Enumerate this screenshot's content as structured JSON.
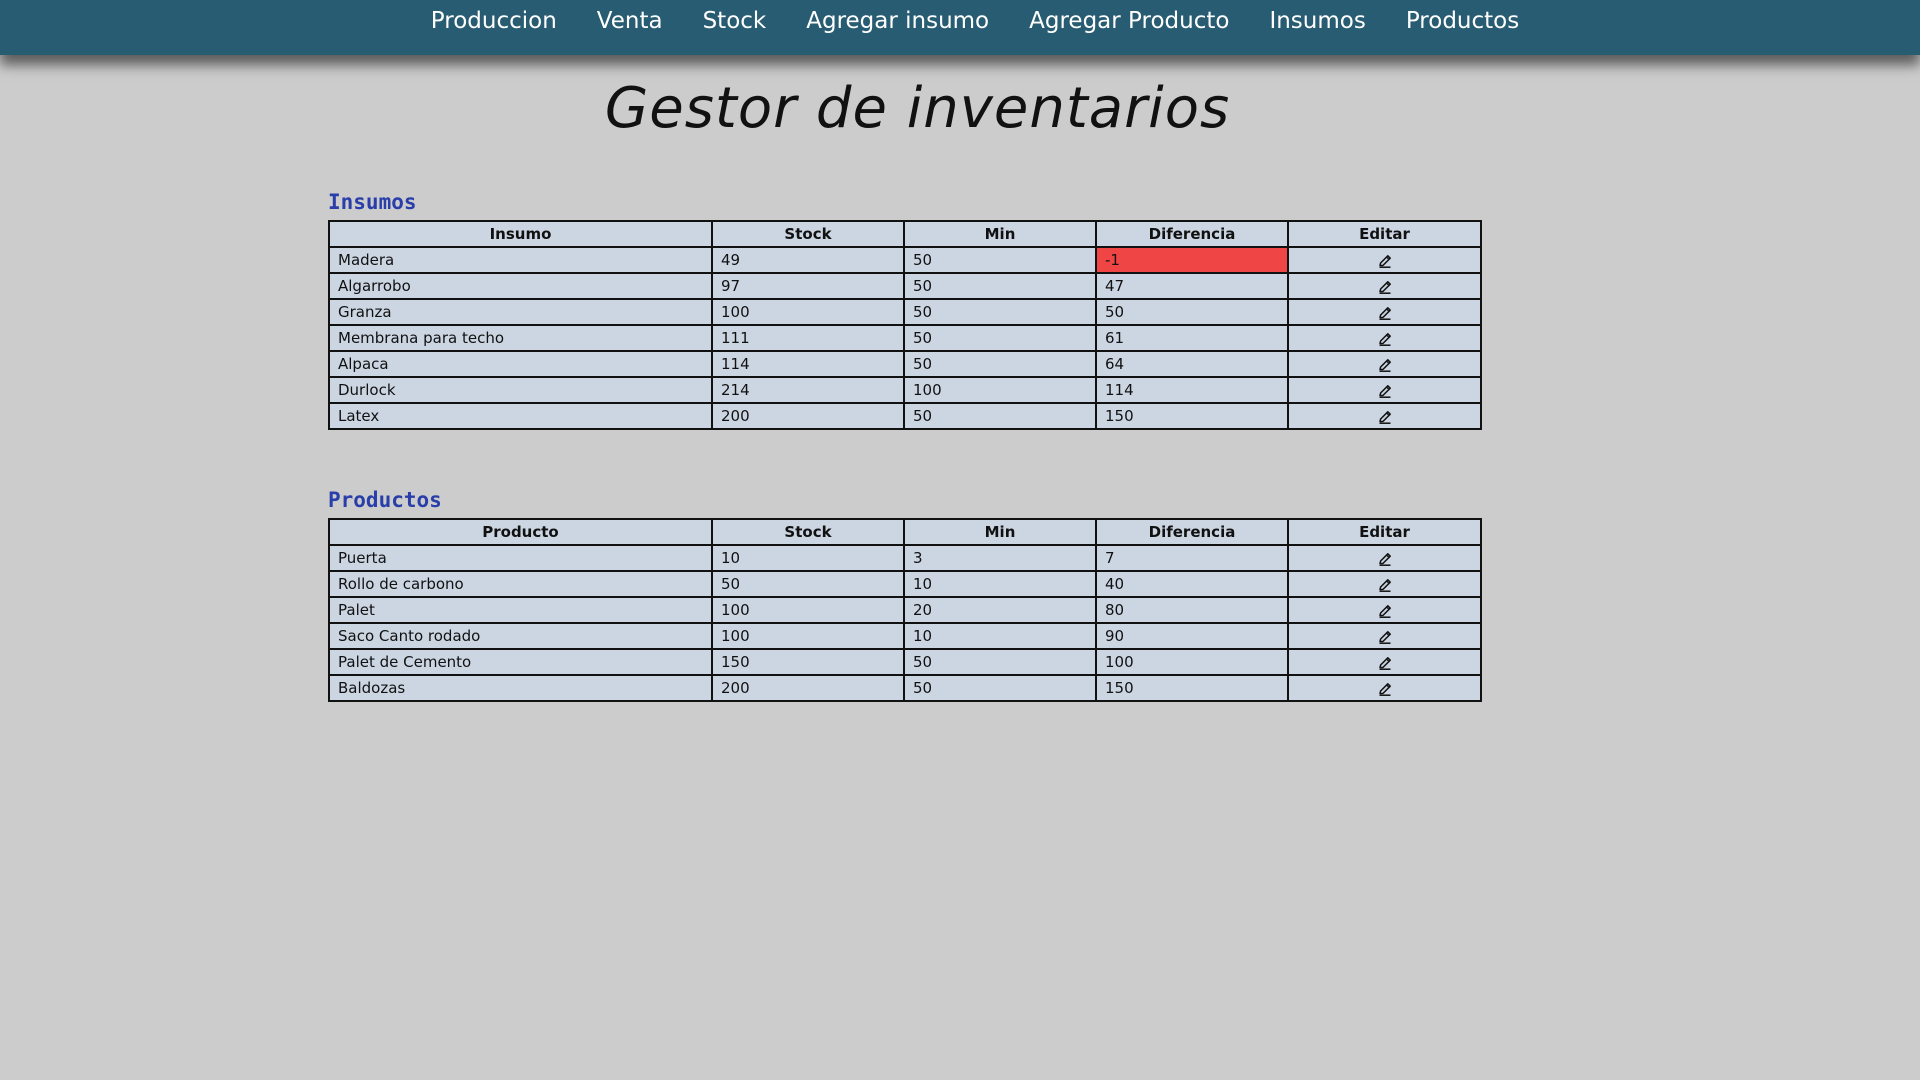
{
  "nav": {
    "items": [
      "Produccion",
      "Venta",
      "Stock",
      "Agregar insumo",
      "Agregar Producto",
      "Insumos",
      "Productos"
    ]
  },
  "page": {
    "title": "Gestor de inventarios"
  },
  "colors": {
    "navbar": "#285c72",
    "background": "#cccccc",
    "cell": "#ccd6e3",
    "negative": "#ef4545",
    "section_title": "#2a3eaa"
  },
  "insumos": {
    "title": "Insumos",
    "headers": [
      "Insumo",
      "Stock",
      "Min",
      "Diferencia",
      "Editar"
    ],
    "rows": [
      {
        "name": "Madera",
        "stock": "49",
        "min": "50",
        "diff": "-1",
        "negative": true
      },
      {
        "name": "Algarrobo",
        "stock": "97",
        "min": "50",
        "diff": "47",
        "negative": false
      },
      {
        "name": "Granza",
        "stock": "100",
        "min": "50",
        "diff": "50",
        "negative": false
      },
      {
        "name": "Membrana para techo",
        "stock": "111",
        "min": "50",
        "diff": "61",
        "negative": false
      },
      {
        "name": "Alpaca",
        "stock": "114",
        "min": "50",
        "diff": "64",
        "negative": false
      },
      {
        "name": "Durlock",
        "stock": "214",
        "min": "100",
        "diff": "114",
        "negative": false
      },
      {
        "name": "Latex",
        "stock": "200",
        "min": "50",
        "diff": "150",
        "negative": false
      }
    ]
  },
  "productos": {
    "title": "Productos",
    "headers": [
      "Producto",
      "Stock",
      "Min",
      "Diferencia",
      "Editar"
    ],
    "rows": [
      {
        "name": "Puerta",
        "stock": "10",
        "min": "3",
        "diff": "7",
        "negative": false
      },
      {
        "name": "Rollo de carbono",
        "stock": "50",
        "min": "10",
        "diff": "40",
        "negative": false
      },
      {
        "name": "Palet",
        "stock": "100",
        "min": "20",
        "diff": "80",
        "negative": false
      },
      {
        "name": "Saco Canto rodado",
        "stock": "100",
        "min": "10",
        "diff": "90",
        "negative": false
      },
      {
        "name": "Palet de Cemento",
        "stock": "150",
        "min": "50",
        "diff": "100",
        "negative": false
      },
      {
        "name": "Baldozas",
        "stock": "200",
        "min": "50",
        "diff": "150",
        "negative": false
      }
    ]
  },
  "icons": {
    "edit": "pencil-icon"
  }
}
